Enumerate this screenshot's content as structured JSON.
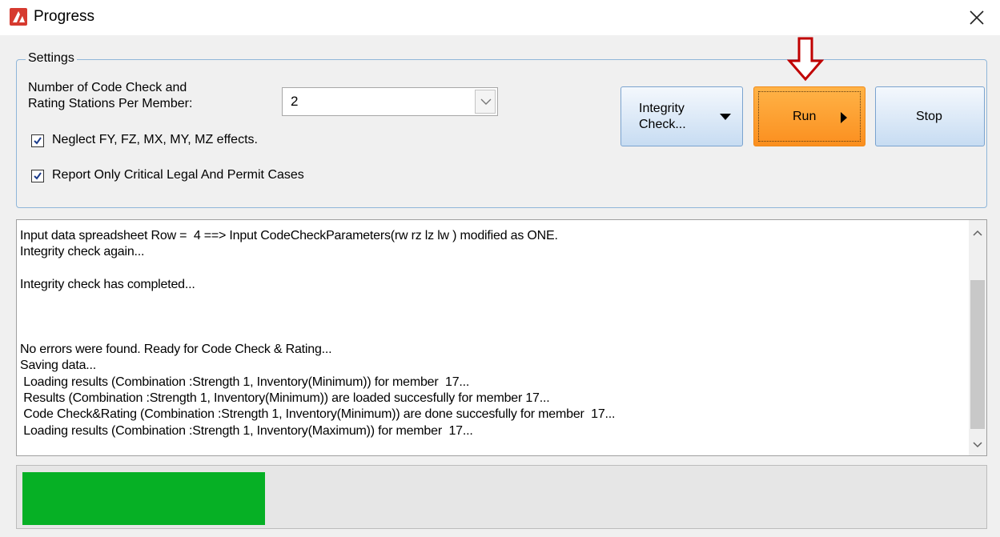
{
  "window": {
    "title": "Progress",
    "close_glyph": "✕"
  },
  "settings": {
    "legend": "Settings",
    "stations_label_line1": "Number of Code Check and",
    "stations_label_line2": "Rating Stations Per Member:",
    "stations_value": "2",
    "neglect_effects": {
      "label": "Neglect FY, FZ, MX, MY, MZ effects.",
      "checked": true
    },
    "report_critical": {
      "label": "Report Only Critical Legal And Permit Cases",
      "checked": true
    }
  },
  "buttons": {
    "integrity_line1": "Integrity",
    "integrity_line2": "Check...",
    "run": "Run",
    "stop": "Stop"
  },
  "log": {
    "lines": [
      "Input data spreadsheet Row =  4 ==> Input CodeCheckParameters(rw rz lz lw ) modified as ONE.",
      "Integrity check again...",
      "",
      "Integrity check has completed...",
      "",
      "",
      "",
      "No errors were found. Ready for Code Check & Rating...",
      "Saving data...",
      " Loading results (Combination :Strength 1, Inventory(Minimum)) for member  17...",
      " Results (Combination :Strength 1, Inventory(Minimum)) are loaded succesfully for member 17...",
      " Code Check&Rating (Combination :Strength 1, Inventory(Minimum)) are done succesfully for member  17...",
      " Loading results (Combination :Strength 1, Inventory(Maximum)) for member  17..."
    ]
  },
  "progress": {
    "fraction": 0.253,
    "color": "#06b025"
  },
  "colors": {
    "run_button": "#fb8f1f",
    "annotation_arrow": "#c00000",
    "group_border": "#8fb6d9"
  }
}
